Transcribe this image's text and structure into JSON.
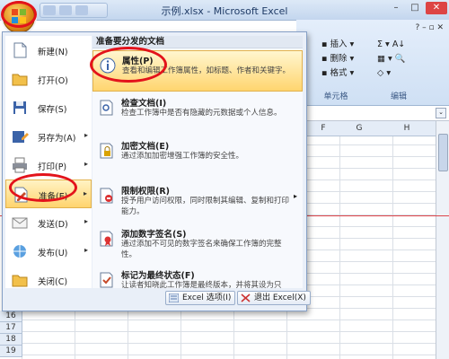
{
  "window": {
    "title": "示例.xlsx - Microsoft Excel"
  },
  "ribbon": {
    "insert": "插入",
    "delete": "删除",
    "format": "格式",
    "cells_group": "单元格",
    "edit_group": "编辑"
  },
  "columns": [
    "F",
    "G",
    "H"
  ],
  "rows": [
    "16",
    "17",
    "18",
    "19"
  ],
  "menu": {
    "left_items": [
      {
        "label": "新建(N)",
        "icon": "new-file-icon"
      },
      {
        "label": "打开(O)",
        "icon": "open-folder-icon"
      },
      {
        "label": "保存(S)",
        "icon": "save-icon"
      },
      {
        "label": "另存为(A)",
        "icon": "save-as-icon"
      },
      {
        "label": "打印(P)",
        "icon": "print-icon"
      },
      {
        "label": "准备(E)",
        "icon": "prepare-icon"
      },
      {
        "label": "发送(D)",
        "icon": "send-icon"
      },
      {
        "label": "发布(U)",
        "icon": "publish-icon"
      },
      {
        "label": "关闭(C)",
        "icon": "close-folder-icon"
      }
    ],
    "right_header": "准备要分发的文档",
    "right_items": [
      {
        "title": "属性(P)",
        "desc": "查看和编辑工作簿属性，如标题、作者和关键字。"
      },
      {
        "title": "检查文档(I)",
        "desc": "检查工作簿中是否有隐藏的元数据或个人信息。"
      },
      {
        "title": "加密文档(E)",
        "desc": "通过添加加密增强工作簿的安全性。"
      },
      {
        "title": "限制权限(R)",
        "desc": "授予用户访问权限，同时限制其编辑、复制和打印能力。"
      },
      {
        "title": "添加数字签名(S)",
        "desc": "通过添加不可见的数字签名来确保工作簿的完整性。"
      },
      {
        "title": "标记为最终状态(F)",
        "desc": "让读者知晓此工作簿是最终版本，并将其设为只读。"
      }
    ],
    "excel_options": "Excel 选项(I)",
    "exit_excel": "退出 Excel(X)"
  },
  "colors": {
    "highlight": "#ffd46e",
    "annotation": "#e3131b"
  }
}
